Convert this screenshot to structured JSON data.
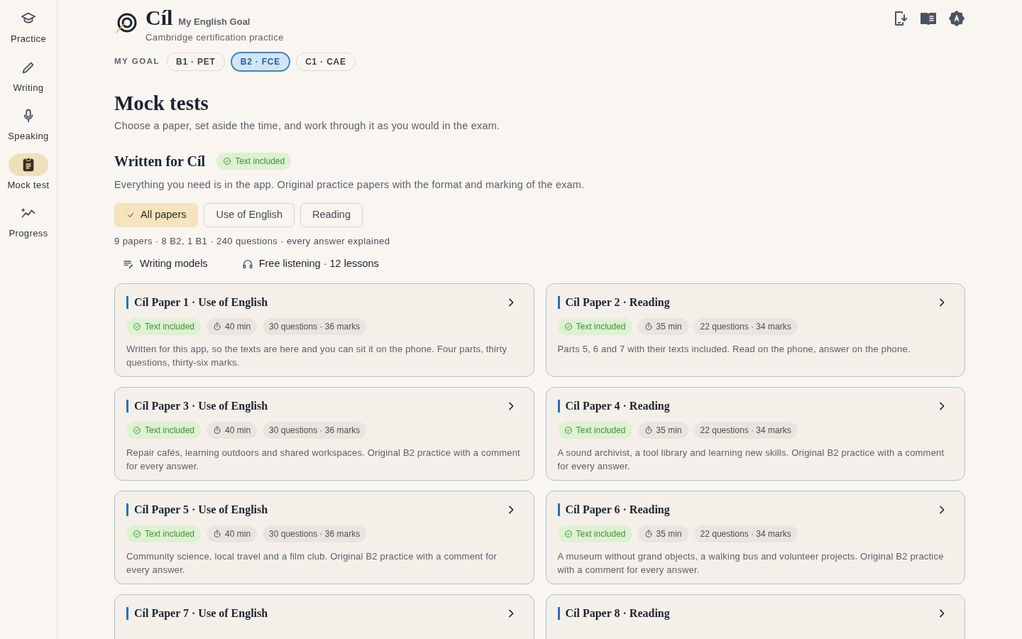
{
  "nav": [
    {
      "label": "Practice",
      "selected": false
    },
    {
      "label": "Writing",
      "selected": false
    },
    {
      "label": "Speaking",
      "selected": false
    },
    {
      "label": "Mock test",
      "selected": true
    },
    {
      "label": "Progress",
      "selected": false
    }
  ],
  "header": {
    "logo": "Cíl",
    "tagline": "My English Goal",
    "subtitle": "Cambridge certification practice"
  },
  "goal": {
    "label": "MY GOAL",
    "options": [
      {
        "label": "B1 · PET",
        "selected": false
      },
      {
        "label": "B2 · FCE",
        "selected": true
      },
      {
        "label": "C1 · CAE",
        "selected": false
      }
    ]
  },
  "page": {
    "title": "Mock tests",
    "intro": "Choose a paper, set aside the time, and work through it as you would in the exam."
  },
  "section": {
    "title": "Written for Cíl",
    "badge": "Text included",
    "intro": "Everything you need is in the app. Original practice papers with the format and marking of the exam."
  },
  "filters": [
    {
      "label": "All papers",
      "selected": true
    },
    {
      "label": "Use of English",
      "selected": false
    },
    {
      "label": "Reading",
      "selected": false
    }
  ],
  "summary": "9 papers · 8 B2, 1 B1 · 240 questions · every answer explained",
  "links": [
    {
      "kind": "writing",
      "label": "Writing models"
    },
    {
      "kind": "listening",
      "label": "Free listening · 12 lessons"
    }
  ],
  "papers": [
    {
      "title": "Cíl Paper 1 · Use of English",
      "chips": [
        {
          "kind": "included",
          "label": "Text included"
        },
        {
          "kind": "time",
          "label": "40 min"
        },
        {
          "kind": "count",
          "label": "30 questions · 36 marks"
        }
      ],
      "description": "Written for this app, so the texts are here and you can sit it on the phone. Four parts, thirty questions, thirty-six marks."
    },
    {
      "title": "Cíl Paper 2 · Reading",
      "chips": [
        {
          "kind": "included",
          "label": "Text included"
        },
        {
          "kind": "time",
          "label": "35 min"
        },
        {
          "kind": "count",
          "label": "22 questions · 34 marks"
        }
      ],
      "description": "Parts 5, 6 and 7 with their texts included. Read on the phone, answer on the phone."
    },
    {
      "title": "Cíl Paper 3 · Use of English",
      "chips": [
        {
          "kind": "included",
          "label": "Text included"
        },
        {
          "kind": "time",
          "label": "40 min"
        },
        {
          "kind": "count",
          "label": "30 questions · 36 marks"
        }
      ],
      "description": "Repair cafés, learning outdoors and shared workspaces. Original B2 practice with a comment for every answer."
    },
    {
      "title": "Cíl Paper 4 · Reading",
      "chips": [
        {
          "kind": "included",
          "label": "Text included"
        },
        {
          "kind": "time",
          "label": "35 min"
        },
        {
          "kind": "count",
          "label": "22 questions · 34 marks"
        }
      ],
      "description": "A sound archivist, a tool library and learning new skills. Original B2 practice with a comment for every answer."
    },
    {
      "title": "Cíl Paper 5 · Use of English",
      "chips": [
        {
          "kind": "included",
          "label": "Text included"
        },
        {
          "kind": "time",
          "label": "40 min"
        },
        {
          "kind": "count",
          "label": "30 questions · 36 marks"
        }
      ],
      "description": "Community science, local travel and a film club. Original B2 practice with a comment for every answer."
    },
    {
      "title": "Cíl Paper 6 · Reading",
      "chips": [
        {
          "kind": "included",
          "label": "Text included"
        },
        {
          "kind": "time",
          "label": "35 min"
        },
        {
          "kind": "count",
          "label": "22 questions · 34 marks"
        }
      ],
      "description": "A museum without grand objects, a walking bus and volunteer projects. Original B2 practice with a comment for every answer."
    },
    {
      "title": "Cíl Paper 7 · Use of English"
    },
    {
      "title": "Cíl Paper 8 · Reading"
    }
  ]
}
